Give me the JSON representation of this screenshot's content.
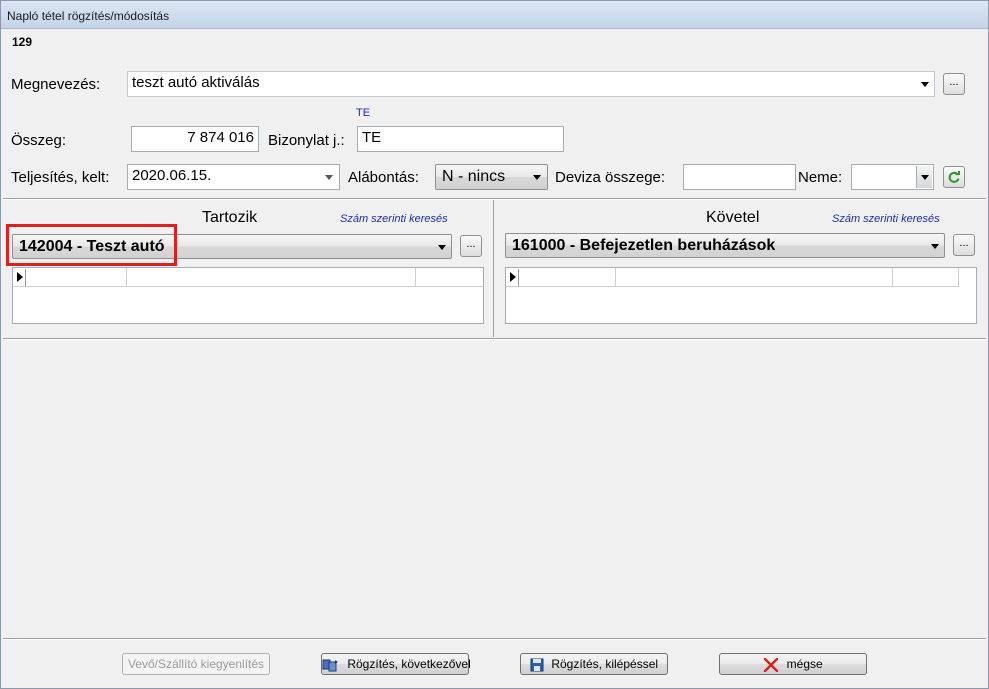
{
  "window": {
    "title": "Napló tétel rögzítés/módosítás"
  },
  "record_id": "129",
  "form": {
    "name_label": "Megnevezés:",
    "name_value": "teszt autó aktiválás",
    "te_hint": "TE",
    "amount_label": "Összeg:",
    "amount_value": "7 874 016",
    "doc_label": "Bizonylat j.:",
    "doc_value": "TE",
    "date_label": "Teljesítés, kelt:",
    "date_value": "2020.06.15.",
    "split_label": "Alábontás:",
    "split_value": "N - nincs",
    "fx_amount_label": "Deviza összege:",
    "fx_amount_value": "",
    "currency_label": "Neme:",
    "currency_value": "",
    "browse_label": "..."
  },
  "debit": {
    "title": "Tartozik",
    "search_link": "Szám szerinti keresés",
    "account": "142004 - Teszt autó"
  },
  "credit": {
    "title": "Követel",
    "search_link": "Szám szerinti keresés",
    "account": "161000 - Befejezetlen beruházások"
  },
  "buttons": {
    "reconcile": "Vevő/Szállító kiegyenlítés",
    "save_next": "Rögzítés, következővel",
    "save_exit": "Rögzítés, kilépéssel",
    "cancel": "mégse"
  },
  "colors": {
    "highlight": "#e0201f",
    "link": "#1b2bb5"
  }
}
